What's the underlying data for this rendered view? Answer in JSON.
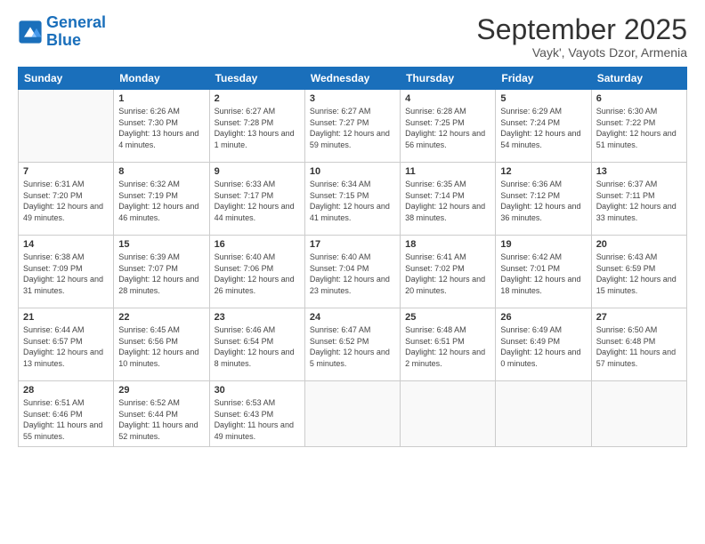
{
  "logo": {
    "text_general": "General",
    "text_blue": "Blue"
  },
  "title": "September 2025",
  "subtitle": "Vayk', Vayots Dzor, Armenia",
  "days_of_week": [
    "Sunday",
    "Monday",
    "Tuesday",
    "Wednesday",
    "Thursday",
    "Friday",
    "Saturday"
  ],
  "weeks": [
    [
      {
        "day": "",
        "sunrise": "",
        "sunset": "",
        "daylight": "",
        "empty": true
      },
      {
        "day": "1",
        "sunrise": "Sunrise: 6:26 AM",
        "sunset": "Sunset: 7:30 PM",
        "daylight": "Daylight: 13 hours and 4 minutes."
      },
      {
        "day": "2",
        "sunrise": "Sunrise: 6:27 AM",
        "sunset": "Sunset: 7:28 PM",
        "daylight": "Daylight: 13 hours and 1 minute."
      },
      {
        "day": "3",
        "sunrise": "Sunrise: 6:27 AM",
        "sunset": "Sunset: 7:27 PM",
        "daylight": "Daylight: 12 hours and 59 minutes."
      },
      {
        "day": "4",
        "sunrise": "Sunrise: 6:28 AM",
        "sunset": "Sunset: 7:25 PM",
        "daylight": "Daylight: 12 hours and 56 minutes."
      },
      {
        "day": "5",
        "sunrise": "Sunrise: 6:29 AM",
        "sunset": "Sunset: 7:24 PM",
        "daylight": "Daylight: 12 hours and 54 minutes."
      },
      {
        "day": "6",
        "sunrise": "Sunrise: 6:30 AM",
        "sunset": "Sunset: 7:22 PM",
        "daylight": "Daylight: 12 hours and 51 minutes."
      }
    ],
    [
      {
        "day": "7",
        "sunrise": "Sunrise: 6:31 AM",
        "sunset": "Sunset: 7:20 PM",
        "daylight": "Daylight: 12 hours and 49 minutes."
      },
      {
        "day": "8",
        "sunrise": "Sunrise: 6:32 AM",
        "sunset": "Sunset: 7:19 PM",
        "daylight": "Daylight: 12 hours and 46 minutes."
      },
      {
        "day": "9",
        "sunrise": "Sunrise: 6:33 AM",
        "sunset": "Sunset: 7:17 PM",
        "daylight": "Daylight: 12 hours and 44 minutes."
      },
      {
        "day": "10",
        "sunrise": "Sunrise: 6:34 AM",
        "sunset": "Sunset: 7:15 PM",
        "daylight": "Daylight: 12 hours and 41 minutes."
      },
      {
        "day": "11",
        "sunrise": "Sunrise: 6:35 AM",
        "sunset": "Sunset: 7:14 PM",
        "daylight": "Daylight: 12 hours and 38 minutes."
      },
      {
        "day": "12",
        "sunrise": "Sunrise: 6:36 AM",
        "sunset": "Sunset: 7:12 PM",
        "daylight": "Daylight: 12 hours and 36 minutes."
      },
      {
        "day": "13",
        "sunrise": "Sunrise: 6:37 AM",
        "sunset": "Sunset: 7:11 PM",
        "daylight": "Daylight: 12 hours and 33 minutes."
      }
    ],
    [
      {
        "day": "14",
        "sunrise": "Sunrise: 6:38 AM",
        "sunset": "Sunset: 7:09 PM",
        "daylight": "Daylight: 12 hours and 31 minutes."
      },
      {
        "day": "15",
        "sunrise": "Sunrise: 6:39 AM",
        "sunset": "Sunset: 7:07 PM",
        "daylight": "Daylight: 12 hours and 28 minutes."
      },
      {
        "day": "16",
        "sunrise": "Sunrise: 6:40 AM",
        "sunset": "Sunset: 7:06 PM",
        "daylight": "Daylight: 12 hours and 26 minutes."
      },
      {
        "day": "17",
        "sunrise": "Sunrise: 6:40 AM",
        "sunset": "Sunset: 7:04 PM",
        "daylight": "Daylight: 12 hours and 23 minutes."
      },
      {
        "day": "18",
        "sunrise": "Sunrise: 6:41 AM",
        "sunset": "Sunset: 7:02 PM",
        "daylight": "Daylight: 12 hours and 20 minutes."
      },
      {
        "day": "19",
        "sunrise": "Sunrise: 6:42 AM",
        "sunset": "Sunset: 7:01 PM",
        "daylight": "Daylight: 12 hours and 18 minutes."
      },
      {
        "day": "20",
        "sunrise": "Sunrise: 6:43 AM",
        "sunset": "Sunset: 6:59 PM",
        "daylight": "Daylight: 12 hours and 15 minutes."
      }
    ],
    [
      {
        "day": "21",
        "sunrise": "Sunrise: 6:44 AM",
        "sunset": "Sunset: 6:57 PM",
        "daylight": "Daylight: 12 hours and 13 minutes."
      },
      {
        "day": "22",
        "sunrise": "Sunrise: 6:45 AM",
        "sunset": "Sunset: 6:56 PM",
        "daylight": "Daylight: 12 hours and 10 minutes."
      },
      {
        "day": "23",
        "sunrise": "Sunrise: 6:46 AM",
        "sunset": "Sunset: 6:54 PM",
        "daylight": "Daylight: 12 hours and 8 minutes."
      },
      {
        "day": "24",
        "sunrise": "Sunrise: 6:47 AM",
        "sunset": "Sunset: 6:52 PM",
        "daylight": "Daylight: 12 hours and 5 minutes."
      },
      {
        "day": "25",
        "sunrise": "Sunrise: 6:48 AM",
        "sunset": "Sunset: 6:51 PM",
        "daylight": "Daylight: 12 hours and 2 minutes."
      },
      {
        "day": "26",
        "sunrise": "Sunrise: 6:49 AM",
        "sunset": "Sunset: 6:49 PM",
        "daylight": "Daylight: 12 hours and 0 minutes."
      },
      {
        "day": "27",
        "sunrise": "Sunrise: 6:50 AM",
        "sunset": "Sunset: 6:48 PM",
        "daylight": "Daylight: 11 hours and 57 minutes."
      }
    ],
    [
      {
        "day": "28",
        "sunrise": "Sunrise: 6:51 AM",
        "sunset": "Sunset: 6:46 PM",
        "daylight": "Daylight: 11 hours and 55 minutes."
      },
      {
        "day": "29",
        "sunrise": "Sunrise: 6:52 AM",
        "sunset": "Sunset: 6:44 PM",
        "daylight": "Daylight: 11 hours and 52 minutes."
      },
      {
        "day": "30",
        "sunrise": "Sunrise: 6:53 AM",
        "sunset": "Sunset: 6:43 PM",
        "daylight": "Daylight: 11 hours and 49 minutes."
      },
      {
        "day": "",
        "sunrise": "",
        "sunset": "",
        "daylight": "",
        "empty": true
      },
      {
        "day": "",
        "sunrise": "",
        "sunset": "",
        "daylight": "",
        "empty": true
      },
      {
        "day": "",
        "sunrise": "",
        "sunset": "",
        "daylight": "",
        "empty": true
      },
      {
        "day": "",
        "sunrise": "",
        "sunset": "",
        "daylight": "",
        "empty": true
      }
    ]
  ]
}
